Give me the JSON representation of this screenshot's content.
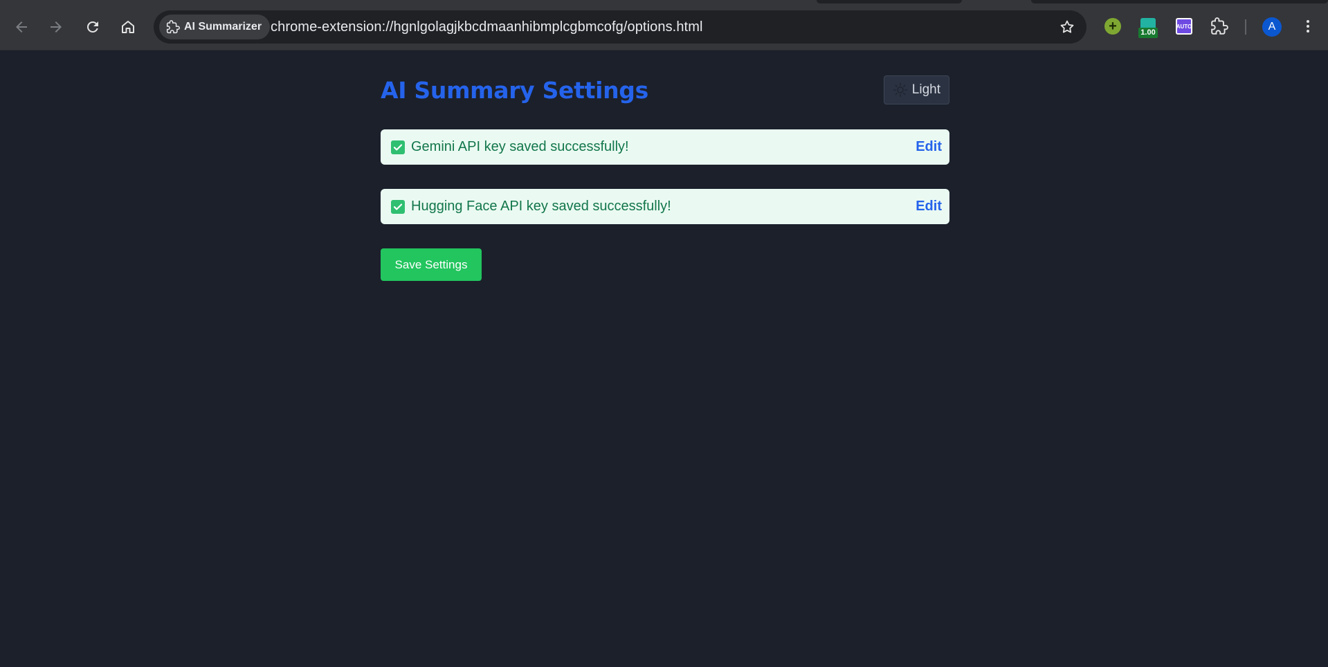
{
  "browser": {
    "site_chip_label": "AI Summarizer",
    "url": "chrome-extension://hgnlgolagjkbcdmaanhibmplcgbmcofg/options.html",
    "extension_badge": "1.00",
    "extension_purple_label": "AUTO",
    "avatar_initial": "A"
  },
  "page": {
    "title": "AI Summary Settings",
    "theme_toggle_label": "Light",
    "status_items": [
      {
        "message": "Gemini API key saved successfully!",
        "edit_label": "Edit"
      },
      {
        "message": "Hugging Face API key saved successfully!",
        "edit_label": "Edit"
      }
    ],
    "save_button_label": "Save Settings"
  },
  "colors": {
    "page_background": "#1b202b",
    "title_blue": "#2563eb",
    "success_background": "#eafaf2",
    "success_text": "#12764a",
    "save_green": "#22c55e"
  }
}
